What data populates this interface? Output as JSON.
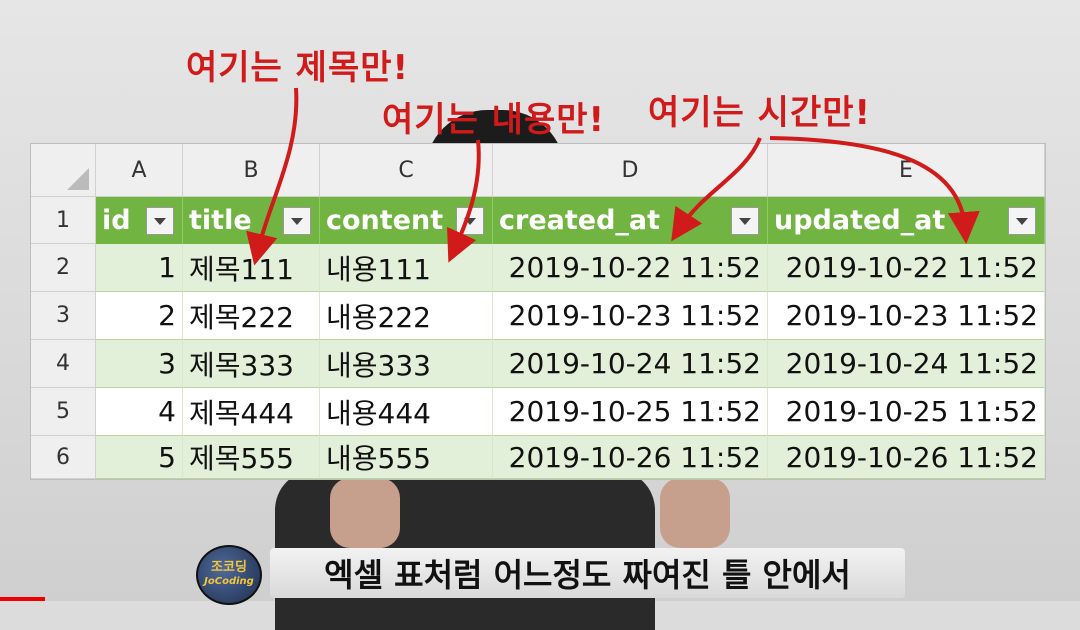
{
  "annotations": [
    "여기는 제목만!",
    "여기는 내용만!",
    "여기는 시간만!"
  ],
  "sheet": {
    "column_letters": [
      "A",
      "B",
      "C",
      "D",
      "E"
    ],
    "row_numbers": [
      "1",
      "2",
      "3",
      "4",
      "5",
      "6"
    ],
    "headers": [
      "id",
      "title",
      "content",
      "created_at",
      "updated_at"
    ],
    "rows": [
      [
        "1",
        "제목111",
        "내용111",
        "2019-10-22 11:52",
        "2019-10-22 11:52"
      ],
      [
        "2",
        "제목222",
        "내용222",
        "2019-10-23 11:52",
        "2019-10-23 11:52"
      ],
      [
        "3",
        "제목333",
        "내용333",
        "2019-10-24 11:52",
        "2019-10-24 11:52"
      ],
      [
        "4",
        "제목444",
        "내용444",
        "2019-10-25 11:52",
        "2019-10-25 11:52"
      ],
      [
        "5",
        "제목555",
        "내용555",
        "2019-10-26 11:52",
        "2019-10-26 11:52"
      ]
    ],
    "header_color": "#72b442",
    "band_color": "#e2efd9"
  },
  "caption": "엑셀 표처럼 어느정도 짜여진 틀 안에서",
  "logo": {
    "line1": "조코딩",
    "line2": "JoCoding"
  },
  "annotation_color": "#d11a1a"
}
